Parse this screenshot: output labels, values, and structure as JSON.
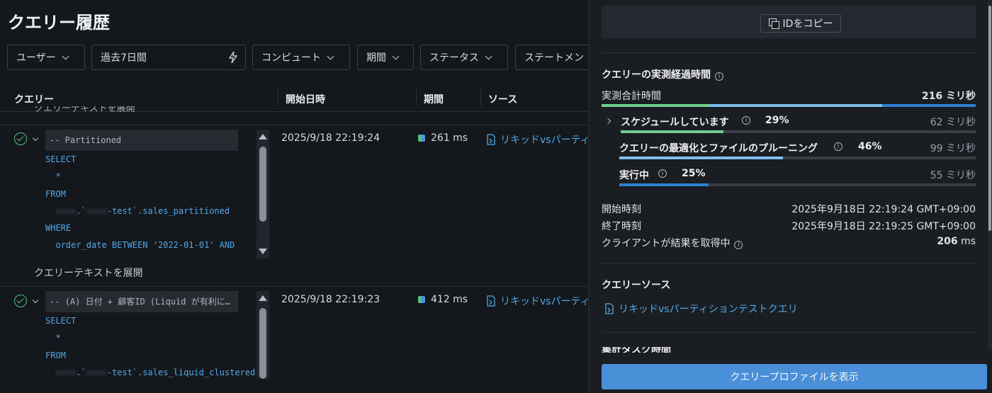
{
  "page_title": "クエリー履歴",
  "filters": {
    "user": "ユーザー",
    "date_range": "過去7日間",
    "compute": "コンピュート",
    "duration": "期間",
    "status": "ステータス",
    "statement": "ステートメン"
  },
  "table": {
    "headers": [
      "クエリー",
      "開始日時",
      "期間",
      "ソース"
    ],
    "cutoff_text": "クエリーテキストを展開",
    "rows": [
      {
        "status_icon": "check-circle-icon",
        "code_lines": [
          "-- Partitioned",
          "SELECT",
          "  *",
          "FROM",
          "    .      -test`.sales_partitioned",
          "WHERE",
          "  order_date BETWEEN '2022-01-01' AND"
        ],
        "code_parts": {
          "blur1": "xxxx",
          "blur2": "xxxx",
          "tbl": "-test`.sales_partitioned"
        },
        "start": "2025/9/18 22:19:24",
        "duration": "261 ms",
        "source": "リキッドvsパーティ",
        "expand_label": "クエリーテキストを展開"
      },
      {
        "status_icon": "check-circle-icon",
        "code_lines": [
          "-- (A) 日付 + 顧客ID (Liquid が有利に…",
          "SELECT",
          "  *",
          "FROM",
          "    .      -test`.sales_liquid_clustered"
        ],
        "code_parts": {
          "blur1": "xxxx",
          "blur2": "xxxx",
          "tbl": "-test`.sales_liquid_clustered"
        },
        "start": "2025/9/18 22:19:23",
        "duration": "412 ms",
        "source": "リキッドvsパーティ"
      }
    ]
  },
  "panel": {
    "copy_id_label": "IDをコピー",
    "elapsed_title": "クエリーの実測経過時間",
    "total_label": "実測合計時間",
    "total_value": "216 ミリ秒",
    "stages": [
      {
        "name": "スケジュールしています",
        "percent": "29%",
        "ms": "62 ミリ秒",
        "fraction": 0.29,
        "color": "#6fcf8f"
      },
      {
        "name": "クエリーの最適化とファイルのプルーニング",
        "percent": "46%",
        "ms": "99 ミリ秒",
        "fraction": 0.46,
        "color": "#7fbff0"
      },
      {
        "name": "実行中",
        "percent": "25%",
        "ms": "55 ミリ秒",
        "fraction": 0.25,
        "color": "#2f7fd0"
      }
    ],
    "start_label": "開始時刻",
    "start_value": "2025年9月18日 22:19:24 GMT+09:00",
    "end_label": "終了時刻",
    "end_value": "2025年9月18日 22:19:25 GMT+09:00",
    "fetch_label": "クライアントが結果を取得中",
    "fetch_value": "206",
    "fetch_unit": "ms",
    "source_title": "クエリーソース",
    "source_link": "リキッドvsパーティションテストクエリ",
    "next_section_cut": "集計タスク時間",
    "profile_button": "クエリープロファイルを表示"
  }
}
